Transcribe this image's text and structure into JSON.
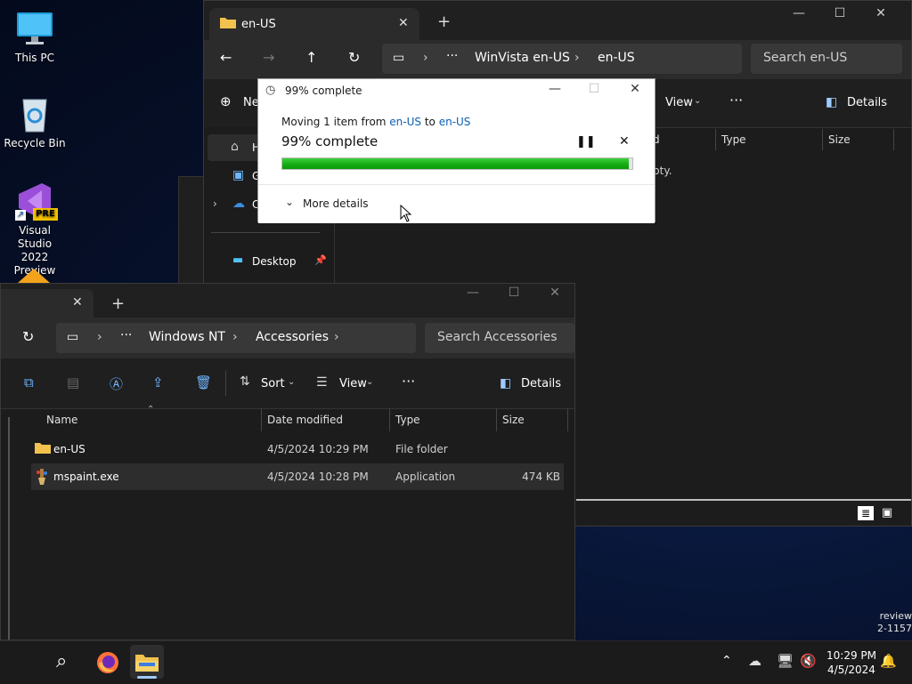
{
  "desktop": {
    "icons": [
      {
        "label": "This PC"
      },
      {
        "label": "Recycle Bin"
      },
      {
        "label": "Visual Studio 2022 Preview",
        "line1": "Visual Studio",
        "line2": "2022 Preview",
        "badge": "PRE"
      }
    ],
    "watermark_line1": "review",
    "watermark_line2": "2-1157"
  },
  "back_window": {
    "tab_title": "en-US",
    "breadcrumb": [
      "WinVista en-US",
      "en-US"
    ],
    "search_placeholder": "Search en-US",
    "new_label": "Ne",
    "view_label": "View",
    "details_label": "Details",
    "columns": [
      "d",
      "Type",
      "Size"
    ],
    "empty_text": "pty.",
    "nav": {
      "home": "H",
      "gallery": "G",
      "onedrive": "C",
      "desktop": "Desktop"
    }
  },
  "dialog": {
    "title": "99% complete",
    "moving_prefix": "Moving 1 item from ",
    "source": "en-US",
    "to_word": " to ",
    "dest": "en-US",
    "status": "99% complete",
    "progress": 0.99,
    "more_details": "More details"
  },
  "front_window": {
    "breadcrumb": [
      "Windows NT",
      "Accessories"
    ],
    "search_placeholder": "Search Accessories",
    "sort_label": "Sort",
    "view_label": "View",
    "details_label": "Details",
    "columns": [
      "Name",
      "Date modified",
      "Type",
      "Size"
    ],
    "rows": [
      {
        "name": "en-US",
        "date": "4/5/2024 10:29 PM",
        "type": "File folder",
        "size": ""
      },
      {
        "name": "mspaint.exe",
        "date": "4/5/2024 10:28 PM",
        "type": "Application",
        "size": "474 KB"
      }
    ]
  },
  "taskbar": {
    "time": "10:29 PM",
    "date": "4/5/2024"
  },
  "colors": {
    "accent_link": "#0a5fb4",
    "progress_green": "#17b017",
    "selected_row": "#2d2d2d"
  }
}
